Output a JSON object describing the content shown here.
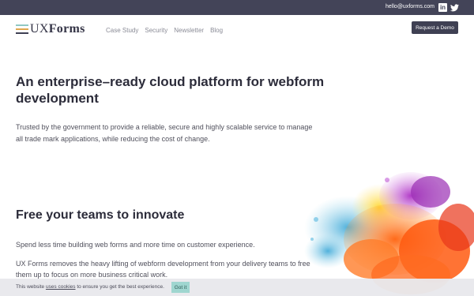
{
  "topbar": {
    "email": "hello@uxforms.com",
    "linkedin_icon": "linkedin-icon",
    "twitter_icon": "twitter-icon",
    "bg_color": "#434458"
  },
  "nav": {
    "logo_part1": "UX",
    "logo_part2": "Forms",
    "links": [
      "Case Study",
      "Security",
      "Newsletter",
      "Blog"
    ],
    "cta_label": "Request a Demo",
    "logo_colors": [
      "#8fc8c3",
      "#e0a84e",
      "#3f4053"
    ]
  },
  "hero": {
    "title": "An enterprise–ready cloud platform for webform development",
    "text": "Trusted by the government to provide a reliable, secure and highly scalable service to manage all trade mark applications, while reducing the cost of change."
  },
  "section": {
    "title": "Free your teams to innovate",
    "para1": "Spend less time building web forms and more time on customer experience.",
    "para2": "UX Forms removes the heavy lifting of webform development from your delivery teams to free them up to focus on more business critical work."
  },
  "cookie": {
    "text_before": "This website ",
    "link": "uses cookies",
    "text_after": " to ensure you get the best experience.",
    "button": "Got it"
  }
}
